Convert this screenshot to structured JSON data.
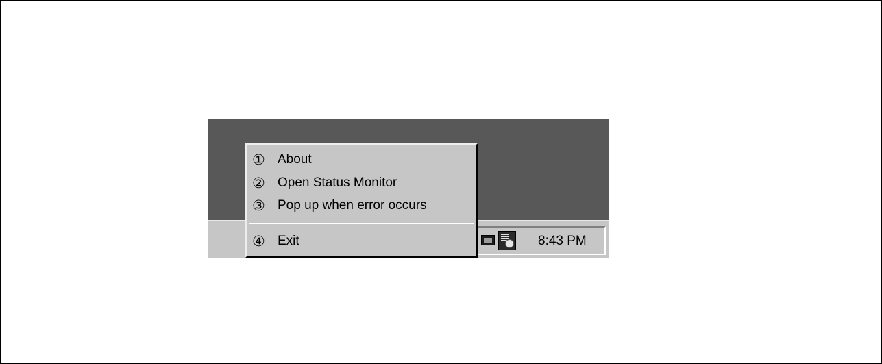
{
  "context_menu": {
    "items": [
      {
        "number": "①",
        "label": "About"
      },
      {
        "number": "②",
        "label": "Open Status Monitor"
      },
      {
        "number": "③",
        "label": "Pop up when error occurs"
      },
      {
        "number": "④",
        "label": "Exit"
      }
    ]
  },
  "taskbar": {
    "tray": {
      "icons": [
        "monitor-icon",
        "printer-status-icon"
      ],
      "clock": "8:43 PM"
    }
  },
  "colors": {
    "desktop": "#585858",
    "taskbar": "#c6c6c6",
    "menu": "#c6c6c6",
    "frame_border": "#000000"
  }
}
